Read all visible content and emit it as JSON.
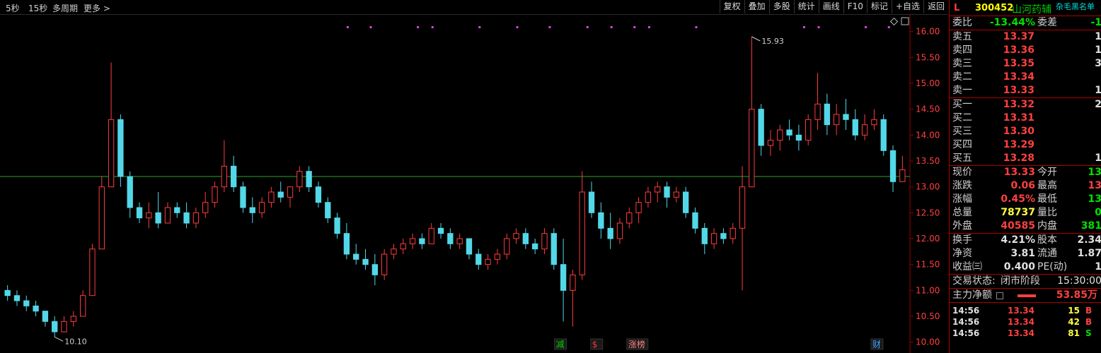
{
  "periods": [
    "5秒",
    "15秒",
    "多周期",
    "更多 >"
  ],
  "toolbar": [
    "复权",
    "叠加",
    "多股",
    "统计",
    "画线",
    "F10",
    "标记",
    "+自选",
    "返回"
  ],
  "chart_corner_icons": [
    "diamond-icon",
    "window-icon"
  ],
  "stock": {
    "mark": "L",
    "code": "300452",
    "name": "山河药辅",
    "tag": "杂毛黑名单"
  },
  "weibi": {
    "label": "委比",
    "value": "-13.44%",
    "label2": "委差",
    "value2": "-1"
  },
  "asks": [
    {
      "label": "卖五",
      "price": "13.37",
      "vol": "1"
    },
    {
      "label": "卖四",
      "price": "13.36",
      "vol": "1"
    },
    {
      "label": "卖三",
      "price": "13.35",
      "vol": "3"
    },
    {
      "label": "卖二",
      "price": "13.34",
      "vol": ""
    },
    {
      "label": "卖一",
      "price": "13.33",
      "vol": "1"
    }
  ],
  "bids": [
    {
      "label": "买一",
      "price": "13.32",
      "vol": "2"
    },
    {
      "label": "买二",
      "price": "13.31",
      "vol": ""
    },
    {
      "label": "买三",
      "price": "13.30",
      "vol": ""
    },
    {
      "label": "买四",
      "price": "13.29",
      "vol": ""
    },
    {
      "label": "买五",
      "price": "13.28",
      "vol": "1"
    }
  ],
  "quote": [
    {
      "l1": "现价",
      "v1": "13.33",
      "c1": "red",
      "l2": "今开",
      "v2": "13",
      "c2": "green"
    },
    {
      "l1": "涨跌",
      "v1": "0.06",
      "c1": "red",
      "l2": "最高",
      "v2": "13",
      "c2": "red"
    },
    {
      "l1": "涨幅",
      "v1": "0.45%",
      "c1": "red",
      "l2": "最低",
      "v2": "13",
      "c2": "green"
    },
    {
      "l1": "总量",
      "v1": "78737",
      "c1": "yellow",
      "l2": "量比",
      "v2": "0",
      "c2": "green"
    },
    {
      "l1": "外盘",
      "v1": "40585",
      "c1": "red",
      "l2": "内盘",
      "v2": "381",
      "c2": "green"
    }
  ],
  "fundamentals": [
    {
      "l1": "换手",
      "v1": "4.21%",
      "l2": "股本",
      "v2": "2.34"
    },
    {
      "l1": "净资",
      "v1": "3.81",
      "l2": "流通",
      "v2": "1.87"
    },
    {
      "l1": "收益㈢",
      "v1": "0.400",
      "l2": "PE(动)",
      "v2": "1"
    }
  ],
  "status": {
    "label": "交易状态:",
    "value": "闭市阶段",
    "time": "15:30:00"
  },
  "main_flow": {
    "label": "主力净额",
    "value": "53.85万"
  },
  "ticks": [
    {
      "time": "14:56",
      "price": "13.34",
      "vol": "15",
      "side": "B"
    },
    {
      "time": "14:56",
      "price": "13.34",
      "vol": "42",
      "side": "B"
    },
    {
      "time": "14:56",
      "price": "13.34",
      "vol": "81",
      "side": "S"
    }
  ],
  "chart_data": {
    "type": "candlestick",
    "ylim": [
      9.9,
      16.2
    ],
    "yticks": [
      "10.00",
      "10.50",
      "11.00",
      "11.50",
      "12.00",
      "12.50",
      "13.00",
      "13.50",
      "14.00",
      "14.50",
      "15.00",
      "15.50",
      "16.00"
    ],
    "reference_price": 13.2,
    "high_label": "15.93",
    "low_label": "10.10",
    "event_markers": [
      {
        "text": "减",
        "color": "#00d000"
      },
      {
        "text": "$",
        "color": "#ff3030"
      },
      {
        "text": "涨榜",
        "color": "#ff8080"
      },
      {
        "text": "财",
        "color": "#40a0ff"
      }
    ],
    "ohlc": [
      [
        11.0,
        11.1,
        10.8,
        10.9
      ],
      [
        10.9,
        11.0,
        10.7,
        10.8
      ],
      [
        10.8,
        10.9,
        10.6,
        10.7
      ],
      [
        10.7,
        10.8,
        10.5,
        10.6
      ],
      [
        10.6,
        10.6,
        10.3,
        10.4
      ],
      [
        10.4,
        10.5,
        10.1,
        10.2
      ],
      [
        10.2,
        10.5,
        10.2,
        10.4
      ],
      [
        10.4,
        10.6,
        10.3,
        10.5
      ],
      [
        10.5,
        11.0,
        10.5,
        10.9
      ],
      [
        10.9,
        11.9,
        10.9,
        11.8
      ],
      [
        11.8,
        13.2,
        11.8,
        13.0
      ],
      [
        13.0,
        15.4,
        13.0,
        14.3
      ],
      [
        14.3,
        14.4,
        13.0,
        13.2
      ],
      [
        13.2,
        13.3,
        12.4,
        12.6
      ],
      [
        12.6,
        12.7,
        12.3,
        12.4
      ],
      [
        12.4,
        12.7,
        12.2,
        12.5
      ],
      [
        12.5,
        12.9,
        12.2,
        12.3
      ],
      [
        12.3,
        12.7,
        12.3,
        12.6
      ],
      [
        12.6,
        12.7,
        12.4,
        12.5
      ],
      [
        12.5,
        12.7,
        12.2,
        12.3
      ],
      [
        12.3,
        12.6,
        12.2,
        12.5
      ],
      [
        12.5,
        12.9,
        12.4,
        12.7
      ],
      [
        12.7,
        13.1,
        12.6,
        13.0
      ],
      [
        13.0,
        13.9,
        12.9,
        13.4
      ],
      [
        13.4,
        13.6,
        12.9,
        13.0
      ],
      [
        13.0,
        13.1,
        12.5,
        12.6
      ],
      [
        12.6,
        12.8,
        12.3,
        12.5
      ],
      [
        12.5,
        12.8,
        12.4,
        12.7
      ],
      [
        12.7,
        13.0,
        12.6,
        12.9
      ],
      [
        12.9,
        13.1,
        12.7,
        12.8
      ],
      [
        12.8,
        13.0,
        12.6,
        13.0
      ],
      [
        13.0,
        13.4,
        12.9,
        13.3
      ],
      [
        13.3,
        13.4,
        12.9,
        13.0
      ],
      [
        13.0,
        13.1,
        12.6,
        12.7
      ],
      [
        12.7,
        12.8,
        12.3,
        12.4
      ],
      [
        12.4,
        12.5,
        12.0,
        12.1
      ],
      [
        12.1,
        12.3,
        11.6,
        11.7
      ],
      [
        11.7,
        11.9,
        11.5,
        11.6
      ],
      [
        11.6,
        11.8,
        11.4,
        11.5
      ],
      [
        11.5,
        11.7,
        11.1,
        11.3
      ],
      [
        11.3,
        11.8,
        11.2,
        11.7
      ],
      [
        11.7,
        11.9,
        11.6,
        11.8
      ],
      [
        11.8,
        12.0,
        11.7,
        11.9
      ],
      [
        11.9,
        12.1,
        11.8,
        12.0
      ],
      [
        12.0,
        12.1,
        11.8,
        11.9
      ],
      [
        11.9,
        12.3,
        11.9,
        12.2
      ],
      [
        12.2,
        12.3,
        12.0,
        12.1
      ],
      [
        12.1,
        12.2,
        11.8,
        11.9
      ],
      [
        11.9,
        12.1,
        11.8,
        12.0
      ],
      [
        12.0,
        12.0,
        11.6,
        11.7
      ],
      [
        11.7,
        11.8,
        11.4,
        11.5
      ],
      [
        11.5,
        11.7,
        11.4,
        11.6
      ],
      [
        11.6,
        11.8,
        11.5,
        11.7
      ],
      [
        11.7,
        12.1,
        11.6,
        12.0
      ],
      [
        12.0,
        12.2,
        11.9,
        12.1
      ],
      [
        12.1,
        12.2,
        11.8,
        11.9
      ],
      [
        11.9,
        12.0,
        11.7,
        11.8
      ],
      [
        11.8,
        12.2,
        11.7,
        12.1
      ],
      [
        12.1,
        12.2,
        11.4,
        11.5
      ],
      [
        11.5,
        12.0,
        10.4,
        11.0
      ],
      [
        11.0,
        11.4,
        10.3,
        11.3
      ],
      [
        11.3,
        13.3,
        11.2,
        12.9
      ],
      [
        12.9,
        13.1,
        12.4,
        12.5
      ],
      [
        12.5,
        12.7,
        12.0,
        12.2
      ],
      [
        12.2,
        12.5,
        11.8,
        12.0
      ],
      [
        12.0,
        12.4,
        11.9,
        12.3
      ],
      [
        12.3,
        12.6,
        12.2,
        12.5
      ],
      [
        12.5,
        12.8,
        12.3,
        12.7
      ],
      [
        12.7,
        13.0,
        12.6,
        12.9
      ],
      [
        12.9,
        13.1,
        12.7,
        13.0
      ],
      [
        13.0,
        13.1,
        12.6,
        12.8
      ],
      [
        12.8,
        13.0,
        12.7,
        12.9
      ],
      [
        12.9,
        13.0,
        12.4,
        12.5
      ],
      [
        12.5,
        12.6,
        12.1,
        12.2
      ],
      [
        12.2,
        12.3,
        11.7,
        11.9
      ],
      [
        11.9,
        12.2,
        11.8,
        12.1
      ],
      [
        12.1,
        12.2,
        11.9,
        12.0
      ],
      [
        12.0,
        12.3,
        11.9,
        12.2
      ],
      [
        12.2,
        13.4,
        11.0,
        13.0
      ],
      [
        13.0,
        15.9,
        13.0,
        14.5
      ],
      [
        14.5,
        14.6,
        13.6,
        13.8
      ],
      [
        13.8,
        14.1,
        13.6,
        13.9
      ],
      [
        13.9,
        14.2,
        13.7,
        14.1
      ],
      [
        14.1,
        14.3,
        13.9,
        14.0
      ],
      [
        14.0,
        14.2,
        13.7,
        13.9
      ],
      [
        13.9,
        14.4,
        13.8,
        14.3
      ],
      [
        14.3,
        15.2,
        14.1,
        14.6
      ],
      [
        14.6,
        14.8,
        14.0,
        14.2
      ],
      [
        14.2,
        14.6,
        14.0,
        14.4
      ],
      [
        14.4,
        14.7,
        14.1,
        14.3
      ],
      [
        14.3,
        14.5,
        13.9,
        14.0
      ],
      [
        14.0,
        14.4,
        13.9,
        14.2
      ],
      [
        14.2,
        14.5,
        14.1,
        14.3
      ],
      [
        14.3,
        14.4,
        13.6,
        13.7
      ],
      [
        13.7,
        13.8,
        12.9,
        13.1
      ],
      [
        13.1,
        13.6,
        13.1,
        13.33
      ]
    ]
  }
}
